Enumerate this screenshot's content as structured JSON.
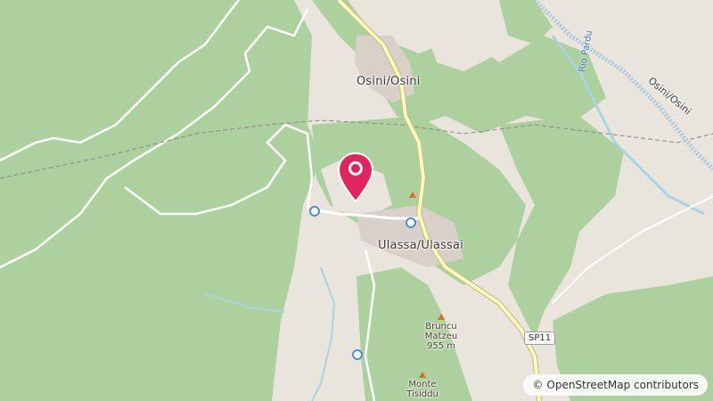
{
  "map": {
    "places": {
      "osini": "Osini/Osini",
      "ulassai": "Ulassa/Ulassai",
      "osini_right": "Osini/Osini"
    },
    "peaks": {
      "bruncu_name": "Bruncu Matzeu",
      "bruncu_elev": "955 m",
      "monte_name": "Monte Tisiddu"
    },
    "water": {
      "rio": "Rio Pardu"
    },
    "roads": {
      "sp11": "SP11"
    },
    "attribution": {
      "symbol": "©",
      "text": "OpenStreetMap contributors"
    },
    "colors": {
      "forest": "#add19e",
      "background": "#e9e5dd",
      "road_major": "#f7fabf",
      "road_minor": "#ffffff",
      "water": "#aad3df",
      "marker": "#e0245e"
    },
    "icons": {
      "marker": "map-pin-icon",
      "peak": "peak-triangle-icon",
      "bus": "bus-stop-icon"
    }
  }
}
